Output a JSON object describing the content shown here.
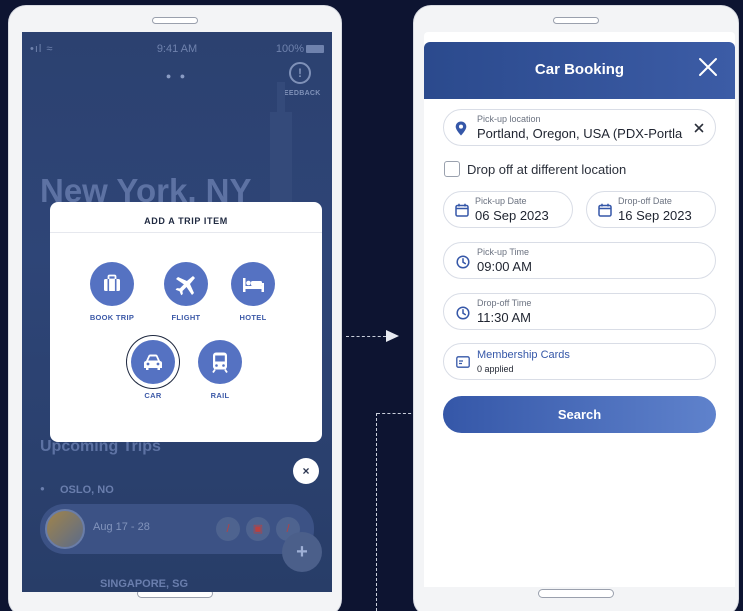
{
  "left_phone": {
    "status_bar": {
      "signal": "•ıl ≈",
      "time": "9:41 AM",
      "battery": "100%"
    },
    "feedback_label": "FEEDBACK",
    "city_title": "New York, NY",
    "upcoming_trips_label": "Upcoming Trips",
    "trips": [
      {
        "name": "OSLO, NO"
      },
      {
        "dates": "Aug 17 - 28"
      },
      {
        "name": "SINGAPORE, SG"
      }
    ],
    "modal": {
      "title": "ADD A TRIP ITEM",
      "options": [
        {
          "label": "BOOK TRIP",
          "icon": "suitcase-icon"
        },
        {
          "label": "FLIGHT",
          "icon": "plane-icon"
        },
        {
          "label": "HOTEL",
          "icon": "bed-icon"
        },
        {
          "label": "CAR",
          "icon": "car-icon",
          "selected": true
        },
        {
          "label": "RAIL",
          "icon": "train-icon"
        }
      ],
      "close_glyph": "×"
    },
    "fab_glyph": "+"
  },
  "car_booking": {
    "title": "Car Booking",
    "pickup_location": {
      "label": "Pick-up location",
      "value": "Portland, Oregon, USA (PDX-Portla"
    },
    "drop_off_toggle_label": "Drop off at different location",
    "pickup_date": {
      "label": "Pick-up Date",
      "value": "06 Sep 2023"
    },
    "dropoff_date": {
      "label": "Drop-off Date",
      "value": "16 Sep 2023"
    },
    "pickup_time": {
      "label": "Pick-up Time",
      "value": "09:00 AM"
    },
    "dropoff_time": {
      "label": "Drop-off Time",
      "value": "11:30 AM"
    },
    "membership": {
      "label": "Membership Cards",
      "value": "0 applied"
    },
    "search_label": "Search"
  },
  "colors": {
    "background": "#0d1431",
    "accent": "#3557a8",
    "header": "#2b4a8d",
    "option_circle": "#5572c2"
  }
}
